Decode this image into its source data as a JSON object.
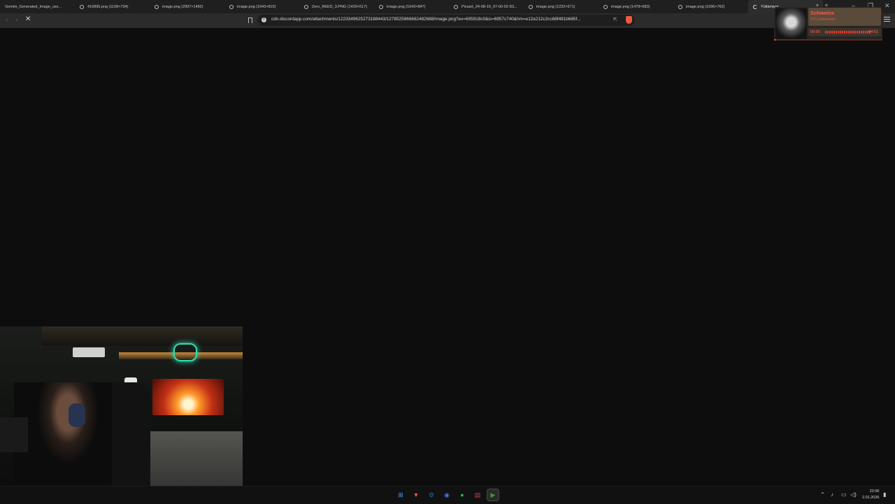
{
  "tabs": [
    {
      "title": "Gemini_Generated_Image_usx...",
      "icon": "none"
    },
    {
      "title": "416895.png (1108×734)",
      "icon": "globe-icon"
    },
    {
      "title": "image.png (2997×1482)",
      "icon": "globe-icon"
    },
    {
      "title": "image.png (1643×815)",
      "icon": "globe-icon"
    },
    {
      "title": "Zero_REED_3.PNG (1429×617)",
      "icon": "globe-icon"
    },
    {
      "title": "image.png (1643×847)",
      "icon": "globe-icon"
    },
    {
      "title": "Picsart_24-08-16_07-00-02-83...",
      "icon": "globe-icon"
    },
    {
      "title": "image.png (1232×671)",
      "icon": "globe-icon"
    },
    {
      "title": "image.png (1478×683)",
      "icon": "globe-icon"
    },
    {
      "title": "image.png (1696×762)",
      "icon": "globe-icon"
    },
    {
      "title": "Yükleniyor...",
      "icon": "loading-spinner-icon",
      "active": true
    }
  ],
  "tab_close": "×",
  "new_tab": "+",
  "window_controls": {
    "minimize": "–",
    "maximize": "❐",
    "close": "✕"
  },
  "nav": {
    "back": "‹",
    "forward": "›",
    "stop": "✕"
  },
  "address": {
    "url": "cdn.discordapp.com/attachments/1223349625273188443/1278525866682482688/image.png?ex=695918c0&is=6957c740&hm=e12e212c2cc68f481b685f..."
  },
  "media": {
    "title": "Schweiss",
    "artist": "Till Lindemann",
    "elapsed": "00:05",
    "total": "04:01",
    "progress": 0.02,
    "accent": "#e8402f"
  },
  "taskbar": {
    "apps": [
      {
        "name": "windows-start-icon",
        "glyph": "⊞",
        "color": "#3aa0ff"
      },
      {
        "name": "brave-browser-icon",
        "glyph": "▼",
        "color": "#f0583a"
      },
      {
        "name": "steam-icon",
        "glyph": "⚙",
        "color": "#1b6fb0"
      },
      {
        "name": "discord-icon",
        "glyph": "◉",
        "color": "#5865f2"
      },
      {
        "name": "spotify-icon",
        "glyph": "●",
        "color": "#1db954"
      },
      {
        "name": "calendar-app-icon",
        "glyph": "▤",
        "color": "#d83a3a"
      },
      {
        "name": "media-player-icon",
        "glyph": "▶",
        "color": "#3a9a3a",
        "active": true
      }
    ],
    "clock_time": "22:06",
    "clock_date": "2.01.2026"
  }
}
